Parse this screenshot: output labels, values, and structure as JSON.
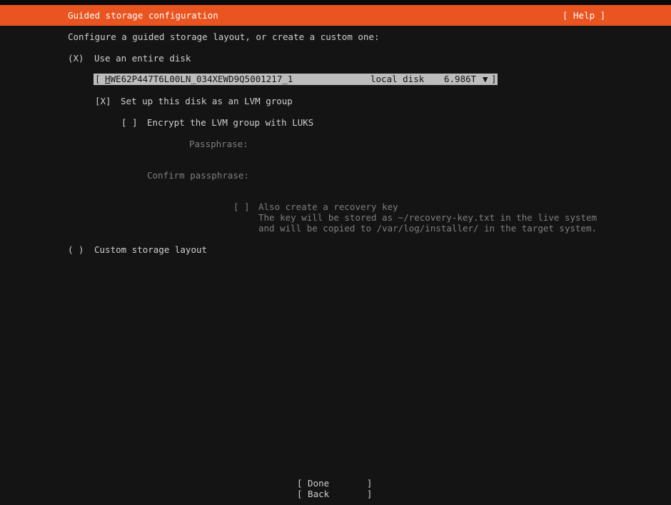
{
  "header": {
    "title": "Guided storage configuration",
    "help": "[ Help ]"
  },
  "intro": "Configure a guided storage layout, or create a custom one:",
  "entire_disk": {
    "radio": "(X)",
    "label": "Use an entire disk"
  },
  "disk_selector": {
    "open_bracket": "[",
    "name_first": "H",
    "name_rest": "WE62P447T6L00LN_034XEWD9Q5001217_1",
    "type": "local disk",
    "size": "6.986T",
    "arrow": "▼",
    "close_bracket": "]"
  },
  "lvm": {
    "checkbox": "[X]",
    "label": "Set up this disk as an LVM group"
  },
  "encrypt": {
    "checkbox": "[ ]",
    "label": "Encrypt the LVM group with LUKS"
  },
  "passphrase_label": "Passphrase:",
  "confirm_label": "Confirm passphrase:",
  "recovery": {
    "checkbox": "[ ]",
    "line1": "Also create a recovery key",
    "line2": "The key will be stored as ~/recovery-key.txt in the live system",
    "line3": "and will be copied to /var/log/installer/ in the target system."
  },
  "custom": {
    "radio": "( )",
    "label": "Custom storage layout"
  },
  "buttons": {
    "done": "[ Done       ]",
    "back": "[ Back       ]"
  }
}
